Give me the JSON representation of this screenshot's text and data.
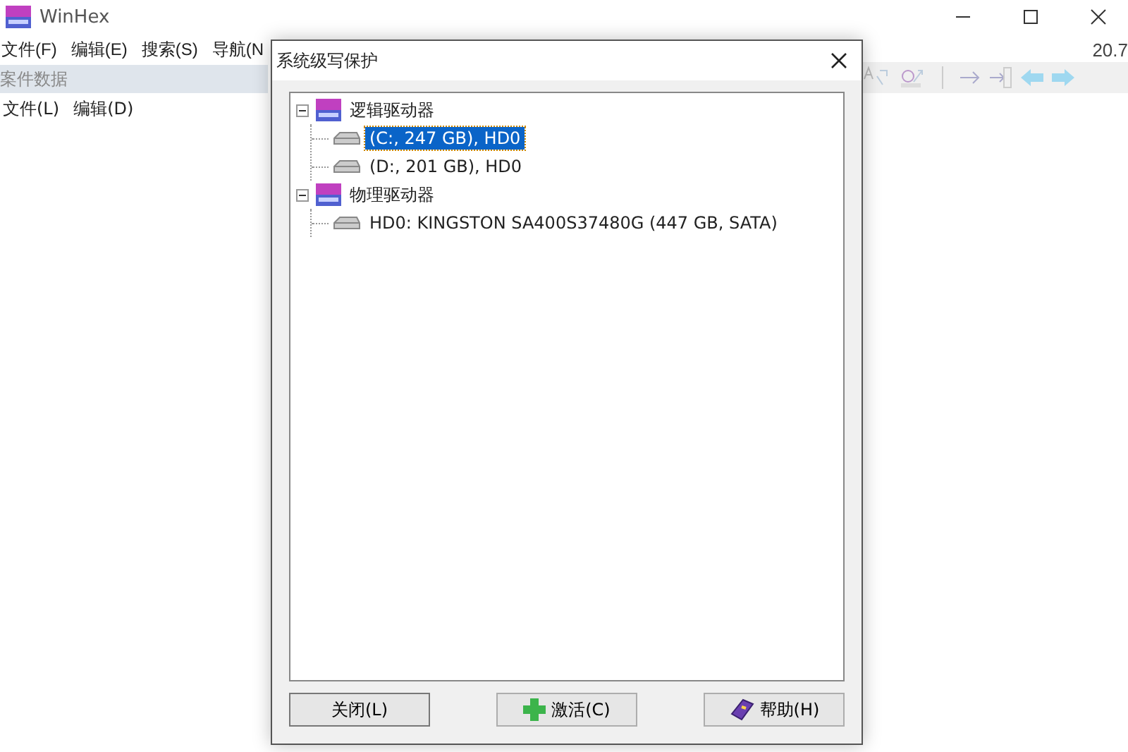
{
  "main_window": {
    "title": "WinHex",
    "menu": [
      "文件(F)",
      "编辑(E)",
      "搜索(S)",
      "导航(N"
    ],
    "version": "20.7"
  },
  "child_window": {
    "title": "案件数据",
    "menu": [
      "文件(L)",
      "编辑(D)"
    ]
  },
  "dialog": {
    "title": "系统级写保护",
    "tree": [
      {
        "label": "逻辑驱动器",
        "expanded": true,
        "children": [
          {
            "label": "(C:, 247 GB), HD0",
            "selected": true
          },
          {
            "label": "(D:, 201 GB), HD0",
            "selected": false
          }
        ]
      },
      {
        "label": "物理驱动器",
        "expanded": true,
        "children": [
          {
            "label": "HD0: KINGSTON SA400S37480G (447 GB, SATA)",
            "selected": false
          }
        ]
      }
    ],
    "buttons": [
      {
        "label": "关闭(L)",
        "kind": "plain"
      },
      {
        "label": "激活(C)",
        "kind": "activate"
      },
      {
        "label": "帮助(H)",
        "kind": "help"
      }
    ]
  }
}
